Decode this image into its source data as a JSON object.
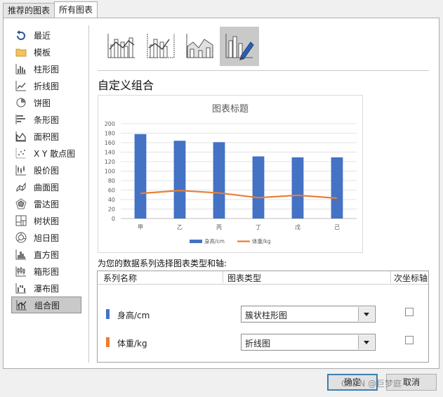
{
  "tabs": [
    "推荐的图表",
    "所有图表"
  ],
  "sidebar": {
    "items": [
      {
        "label": "最近",
        "icon": "recent-icon"
      },
      {
        "label": "模板",
        "icon": "folder-icon"
      },
      {
        "label": "柱形图",
        "icon": "column-chart-icon"
      },
      {
        "label": "折线图",
        "icon": "line-chart-icon"
      },
      {
        "label": "饼图",
        "icon": "pie-chart-icon"
      },
      {
        "label": "条形图",
        "icon": "bar-chart-icon"
      },
      {
        "label": "面积图",
        "icon": "area-chart-icon"
      },
      {
        "label": "X Y 散点图",
        "icon": "scatter-chart-icon"
      },
      {
        "label": "股价图",
        "icon": "stock-chart-icon"
      },
      {
        "label": "曲面图",
        "icon": "surface-chart-icon"
      },
      {
        "label": "雷达图",
        "icon": "radar-chart-icon"
      },
      {
        "label": "树状图",
        "icon": "treemap-chart-icon"
      },
      {
        "label": "旭日图",
        "icon": "sunburst-chart-icon"
      },
      {
        "label": "直方图",
        "icon": "histogram-chart-icon"
      },
      {
        "label": "箱形图",
        "icon": "box-whisker-chart-icon"
      },
      {
        "label": "瀑布图",
        "icon": "waterfall-chart-icon"
      },
      {
        "label": "组合图",
        "icon": "combo-chart-icon"
      }
    ],
    "selected_index": 16
  },
  "subtypes": {
    "icons": [
      "clustered-column-line-icon",
      "clustered-column-line-secondary-axis-icon",
      "stacked-area-clustered-column-icon",
      "custom-combination-icon"
    ],
    "selected_index": 3
  },
  "section_title": "自定义组合",
  "chart_data": {
    "type": "bar",
    "title": "图表标题",
    "categories": [
      "甲",
      "乙",
      "丙",
      "丁",
      "戊",
      "己"
    ],
    "series": [
      {
        "name": "身高/cm",
        "type": "bar",
        "color": "#4472c4",
        "values": [
          178,
          164,
          161,
          131,
          129,
          129
        ]
      },
      {
        "name": "体重/kg",
        "type": "line",
        "color": "#ed7d31",
        "values": [
          53,
          59,
          54,
          44,
          49,
          43
        ]
      }
    ],
    "ylim": [
      0,
      200
    ],
    "yticks": [
      0,
      20,
      40,
      60,
      80,
      100,
      120,
      140,
      160,
      180,
      200
    ],
    "grid": true,
    "legend": "bottom"
  },
  "assign_label": "为您的数据系列选择图表类型和轴:",
  "table": {
    "headers": {
      "series_name": "系列名称",
      "chart_type": "图表类型",
      "secondary_axis": "次坐标轴"
    },
    "rows": [
      {
        "name": "身高/cm",
        "color": "#4472c4",
        "chart_type": "簇状柱形图",
        "secondary": false
      },
      {
        "name": "体重/kg",
        "color": "#ed7d31",
        "chart_type": "折线图",
        "secondary": false
      }
    ]
  },
  "buttons": {
    "ok": "确定",
    "cancel": "取消"
  },
  "watermark": "CSDN @巨梦庭"
}
